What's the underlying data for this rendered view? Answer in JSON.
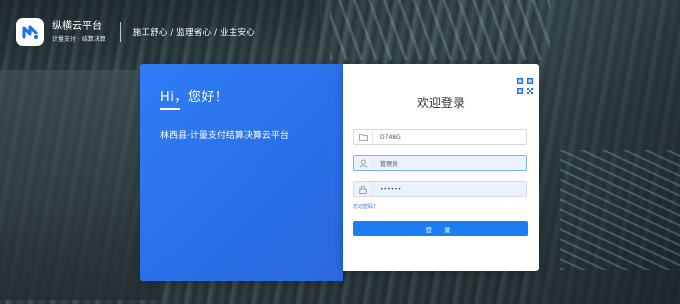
{
  "brand": {
    "title": "纵横云平台",
    "subtitle": "计量支付 · 结算决算",
    "slogan": "施工舒心 / 监理省心 / 业主安心"
  },
  "welcome_panel": {
    "greeting": "Hi，您好！",
    "platform_name": "林西县·计量支付结算决算云平台"
  },
  "login": {
    "title": "欢迎登录",
    "project_code": "D748G",
    "username": "管理员",
    "password_masked": "••••••",
    "forgot_link": "忘记密码?",
    "submit_label": "登 录"
  },
  "colors": {
    "accent": "#1e7cf2",
    "panel": "#2f7cf6"
  },
  "icons": {
    "logo": "zongheng-logo-icon",
    "project": "folder-icon",
    "user": "user-icon",
    "password": "lock-icon",
    "qr": "qr-code-icon"
  }
}
